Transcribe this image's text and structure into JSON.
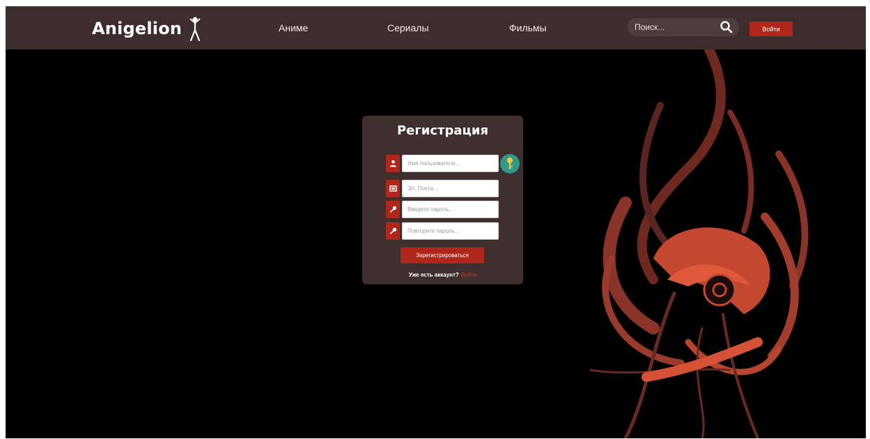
{
  "header": {
    "logo_text": "Anigelion",
    "nav": {
      "anime": "Аниме",
      "serials": "Сериалы",
      "films": "Фильмы"
    },
    "search_placeholder": "Поиск...",
    "login_label": "Войти"
  },
  "registration": {
    "title": "Регистрация",
    "fields": {
      "username_placeholder": "Имя пользователя...",
      "email_placeholder": "Эл. Почта...",
      "password_placeholder": "Введите пароль...",
      "password_repeat_placeholder": "Повторите пароль..."
    },
    "submit_label": "Зарегистрироваться",
    "have_account_text": "Уже есть аккаунт?",
    "signin_link": "Войти"
  },
  "colors": {
    "header_bg": "#3e2d2d",
    "accent": "#b1261a",
    "card_bg": "#3f2f2f",
    "badge": "#2e9a8a"
  },
  "icons": {
    "logo": "figure-icon",
    "search": "search-icon",
    "username": "user-icon",
    "email": "mail-icon",
    "password": "key-icon",
    "password_repeat": "key-icon",
    "badge": "key-badge-icon"
  }
}
